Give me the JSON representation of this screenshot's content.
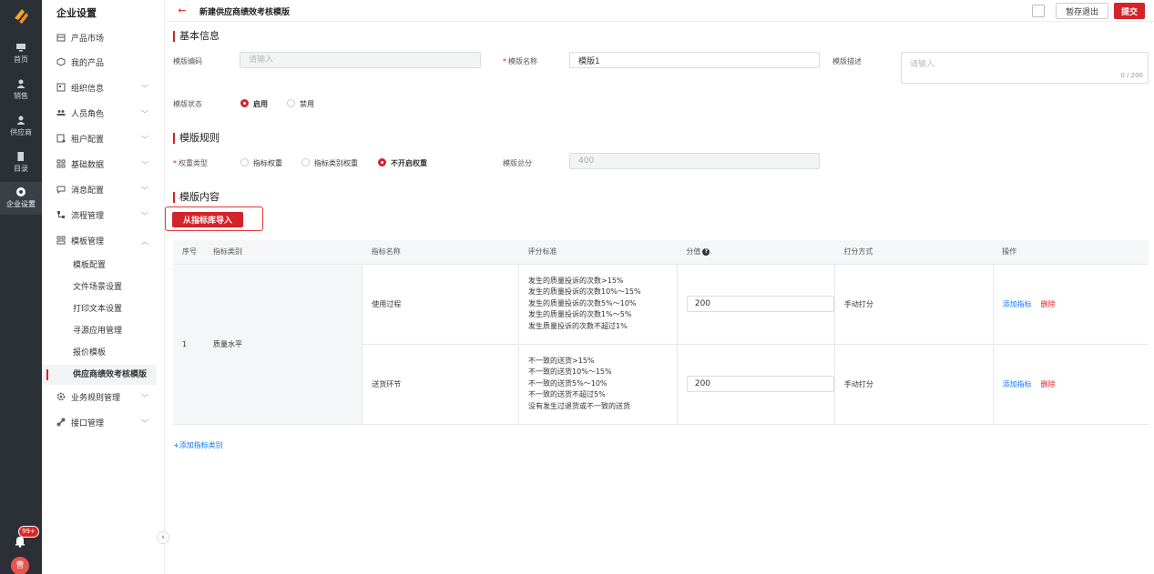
{
  "rail": {
    "items": [
      {
        "label": "首页",
        "icon": "monitor-icon"
      },
      {
        "label": "销售",
        "icon": "user-icon"
      },
      {
        "label": "供应商",
        "icon": "user-icon"
      },
      {
        "label": "目录",
        "icon": "book-icon"
      },
      {
        "label": "企业设置",
        "icon": "settings-icon"
      }
    ],
    "badge": "99+",
    "avatar": "曹"
  },
  "sidebar": {
    "title": "企业设置",
    "items": [
      {
        "label": "产品市场",
        "icon": "store-icon",
        "chevron": ""
      },
      {
        "label": "我的产品",
        "icon": "box-icon",
        "chevron": ""
      },
      {
        "label": "组织信息",
        "icon": "org-icon",
        "chevron": "﹀"
      },
      {
        "label": "人员角色",
        "icon": "users-icon",
        "chevron": "﹀"
      },
      {
        "label": "租户配置",
        "icon": "tenant-icon",
        "chevron": "﹀"
      },
      {
        "label": "基础数据",
        "icon": "data-icon",
        "chevron": "﹀"
      },
      {
        "label": "消息配置",
        "icon": "message-icon",
        "chevron": "﹀"
      },
      {
        "label": "流程管理",
        "icon": "flow-icon",
        "chevron": "﹀"
      },
      {
        "label": "模板管理",
        "icon": "template-icon",
        "chevron": "︿"
      }
    ],
    "subitems": [
      "模板配置",
      "文件场景设置",
      "打印文本设置",
      "寻源应用管理",
      "报价模板",
      "供应商绩效考核模版"
    ],
    "after": [
      {
        "label": "业务规则管理",
        "icon": "gear-icon",
        "chevron": "﹀"
      },
      {
        "label": "接口管理",
        "icon": "link-icon",
        "chevron": "﹀"
      }
    ]
  },
  "header": {
    "title": "新建供应商绩效考核模版",
    "save_label": "暂存退出",
    "submit_label": "提交"
  },
  "basic": {
    "section": "基本信息",
    "code_label": "模版编码",
    "code_placeholder": "请输入",
    "name_label": "模版名称",
    "name_value": "模版1",
    "desc_label": "模版描述",
    "desc_placeholder": "请输入",
    "desc_count": "0 / 200",
    "status_label": "模版状态",
    "status_on": "启用",
    "status_off": "禁用"
  },
  "rules": {
    "section": "模版规则",
    "weight_label": "权重类型",
    "options": [
      "指标权重",
      "指标类别权重",
      "不开启权重"
    ],
    "total_label": "模版总分",
    "total_value": "400"
  },
  "content": {
    "section": "模版内容",
    "import_label": "从指标库导入",
    "add_category": "+添加指标类别"
  },
  "table": {
    "headers": [
      "序号",
      "指标类别",
      "指标名称",
      "评分标准",
      "分值",
      "打分方式",
      "操作"
    ],
    "group": {
      "index": "1",
      "category": "质量水平"
    },
    "rows": [
      {
        "name": "使用过程",
        "criteria": [
          "发生的质量投诉的次数>15%",
          "发生的质量投诉的次数10%～15%",
          "发生的质量投诉的次数5%～10%",
          "发生的质量投诉的次数1%～5%",
          "发生质量投诉的次数不超过1%"
        ],
        "score": "200",
        "method": "手动打分"
      },
      {
        "name": "送货环节",
        "criteria": [
          "不一致的送货>15%",
          "不一致的送货10%～15%",
          "不一致的送货5%～10%",
          "不一致的送货不超过5%",
          "没有发生过退货或不一致的送货"
        ],
        "score": "200",
        "method": "手动打分"
      }
    ],
    "op_add": "添加指标",
    "op_del": "删除"
  },
  "colors": {
    "accent": "#d4232a",
    "link": "#1677ff",
    "rail": "#2b2f36"
  }
}
